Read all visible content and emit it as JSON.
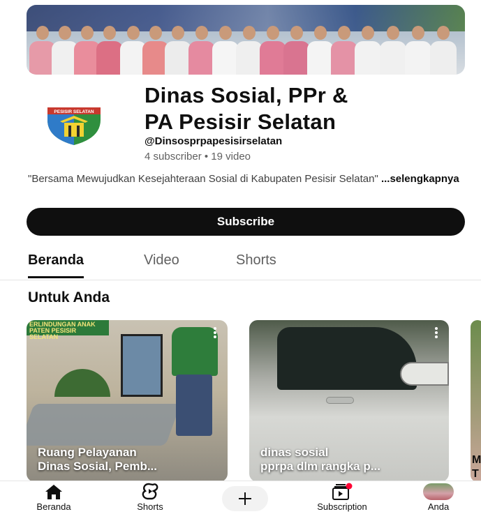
{
  "channel": {
    "title_line1": "Dinas Sosial, PPr &",
    "title_line2": "PA Pesisir Selatan",
    "handle": "@Dinsosprpapesisirselatan",
    "stats": "4 subscriber • 19 video",
    "description": "\"Bersama Mewujudkan Kesejahteraan Sosial di Kabupaten Pesisir Selatan\"",
    "description_more": "...selengkapnya",
    "logo_text": "PESISIR SELATAN"
  },
  "subscribe_label": "Subscribe",
  "tabs": [
    {
      "label": "Beranda",
      "active": true
    },
    {
      "label": "Video",
      "active": false
    },
    {
      "label": "Shorts",
      "active": false
    }
  ],
  "section": {
    "title": "Untuk Anda"
  },
  "shorts": [
    {
      "title": "Ruang Pelayanan\nDinas Sosial, Pemb...",
      "sign_text": "ERLINDUNGAN ANAK\nPATEN PESISIR SELATAN"
    },
    {
      "title": "dinas sosial\npprpa dlm rangka p..."
    },
    {
      "title": "M\nT"
    }
  ],
  "bottom_nav": [
    {
      "label": "Beranda",
      "icon": "home-icon"
    },
    {
      "label": "Shorts",
      "icon": "shorts-icon"
    },
    {
      "label": "",
      "icon": "plus-icon"
    },
    {
      "label": "Subscription",
      "icon": "subscriptions-icon"
    },
    {
      "label": "Anda",
      "icon": "avatar"
    }
  ],
  "colors": {
    "primary_text": "#0f0f0f",
    "secondary_text": "#606060",
    "subscribe_bg": "#0f0f0f",
    "notification_dot": "#ff0033"
  }
}
